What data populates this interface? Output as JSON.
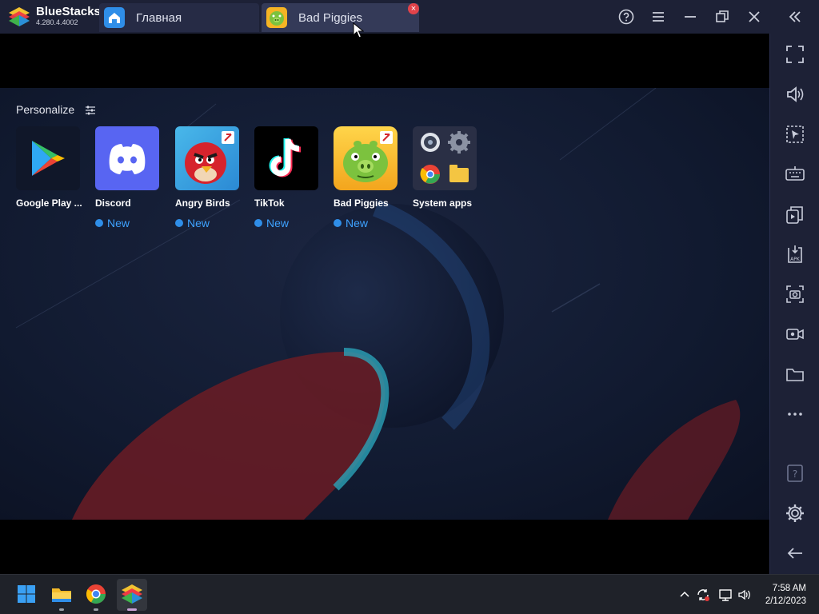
{
  "app": {
    "name": "BlueStacks",
    "version": "4.280.4.4002"
  },
  "tabs": [
    {
      "label": "Главная",
      "icon": "home-icon"
    },
    {
      "label": "Bad Piggies",
      "icon": "bad-piggies-icon",
      "active": true
    }
  ],
  "title_controls": [
    "help-icon",
    "menu-icon",
    "minimize-icon",
    "restore-icon",
    "close-icon",
    "collapse-sidebar-icon"
  ],
  "home": {
    "section_title": "Personalize",
    "apps": [
      {
        "name": "Google Play ...",
        "badge": ""
      },
      {
        "name": "Discord",
        "badge": "New"
      },
      {
        "name": "Angry Birds",
        "badge": "New"
      },
      {
        "name": "TikTok",
        "badge": "New"
      },
      {
        "name": "Bad Piggies",
        "badge": "New"
      },
      {
        "name": "System apps",
        "badge": ""
      }
    ]
  },
  "sidebar": [
    "fullscreen-icon",
    "volume-icon",
    "pointer-icon",
    "keyboard-icon",
    "multi-instance-icon",
    "install-apk-icon",
    "screenshot-icon",
    "record-icon",
    "folder-icon",
    "more-icon",
    "help-icon",
    "settings-icon",
    "back-icon"
  ],
  "taskbar": {
    "apps": [
      "windows-start-icon",
      "file-explorer-icon",
      "chrome-icon",
      "bluestacks-icon"
    ],
    "tray": [
      "chevron-up-icon",
      "sync-icon",
      "network-icon",
      "volume-icon"
    ],
    "time": "7:58 AM",
    "date": "2/12/2023"
  },
  "colors": {
    "titlebar": "#1d2136",
    "accent": "#3ea2ff",
    "close": "#e2434a"
  }
}
